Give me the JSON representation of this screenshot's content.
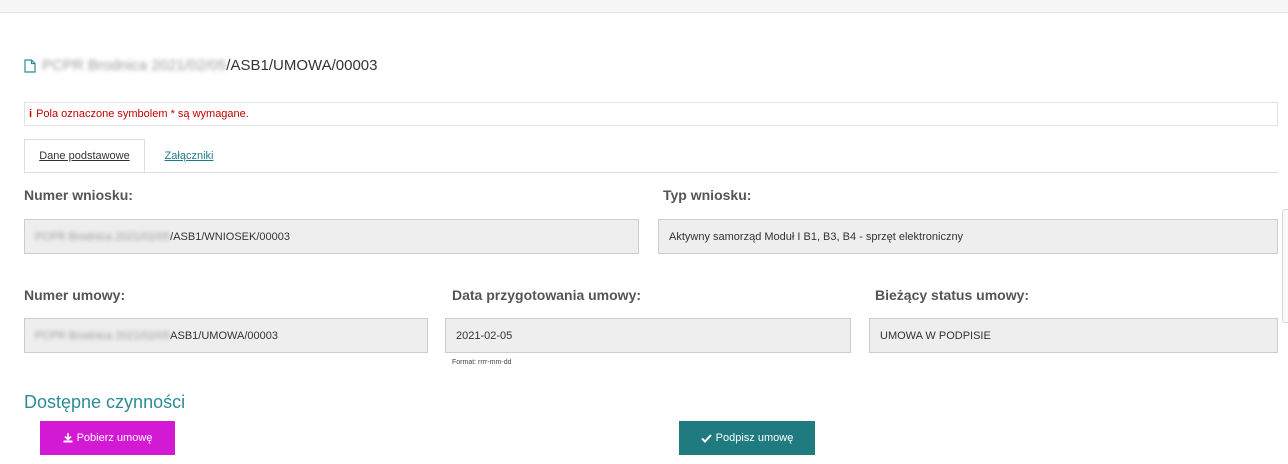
{
  "document": {
    "title_blurred": "PCPR Brodnica 2021/02/05",
    "title_suffix": "/ASB1/UMOWA/00003"
  },
  "notice": {
    "icon": "info-icon",
    "text": "Pola oznaczone symbolem * są wymagane."
  },
  "tabs": [
    {
      "label": "Dane podstawowe",
      "active": true
    },
    {
      "label": "Załączniki",
      "active": false
    }
  ],
  "fields": {
    "numer_wniosku": {
      "label": "Numer wniosku:",
      "value_blurred": "PCPR Brodnica 2021/02/05",
      "value_suffix": "/ASB1/WNIOSEK/00003"
    },
    "typ_wniosku": {
      "label": "Typ wniosku:",
      "value": "Aktywny samorząd Moduł I B1, B3, B4 - sprzęt elektroniczny"
    },
    "numer_umowy": {
      "label": "Numer umowy:",
      "value_blurred": "PCPR Brodnica 2021/02/05",
      "value_suffix": "ASB1/UMOWA/00003"
    },
    "data_przygotowania": {
      "label": "Data przygotowania umowy:",
      "value": "2021-02-05",
      "hint": "Format: rrrr-mm-dd"
    },
    "status": {
      "label": "Bieżący status umowy:",
      "value": "UMOWA W PODPISIE"
    }
  },
  "actions": {
    "title": "Dostępne czynności",
    "download_label": "Pobierz umowę",
    "sign_label": "Podpisz umowę"
  },
  "colors": {
    "accent": "#2a8c96",
    "download_button": "#d419d4",
    "sign_button": "#1f7b7f",
    "required_text": "#c00000"
  }
}
